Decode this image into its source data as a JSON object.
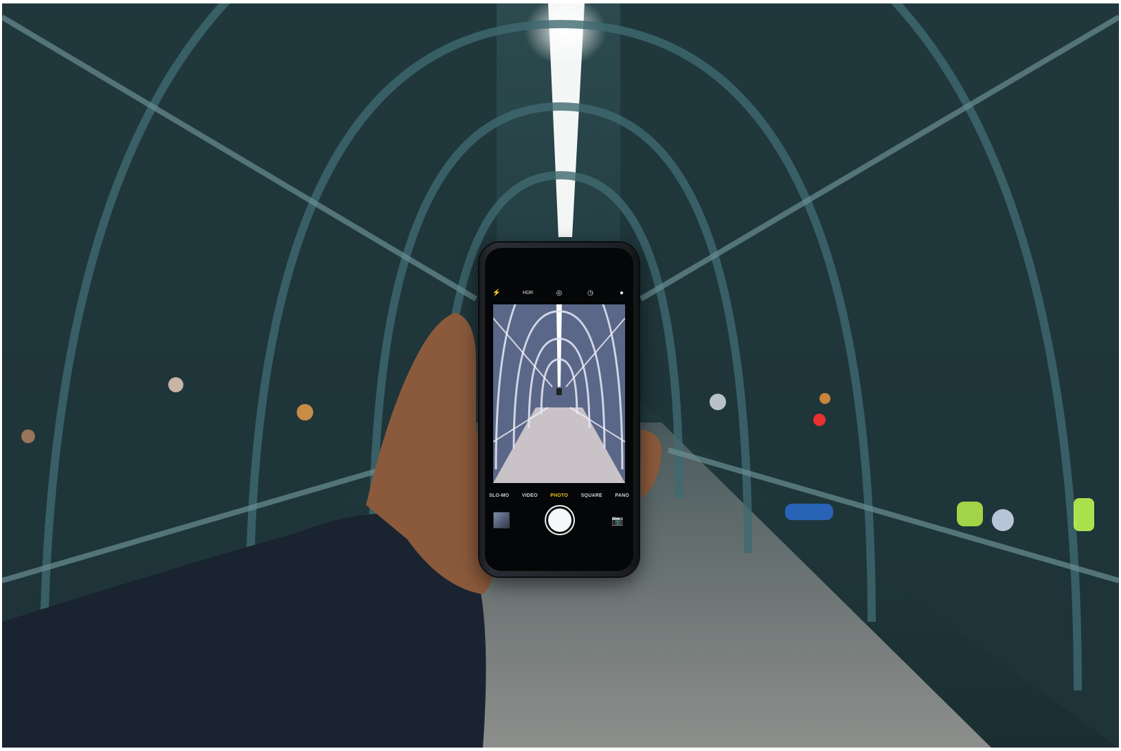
{
  "camera_app": {
    "top_icons": [
      {
        "icon": "flash-off-icon",
        "glyph": "⚡"
      },
      {
        "icon": "hdr-icon",
        "glyph": "HDR"
      },
      {
        "icon": "live-photo-icon",
        "glyph": "◎"
      },
      {
        "icon": "timer-icon",
        "glyph": "◷"
      },
      {
        "icon": "filters-icon",
        "glyph": "●"
      }
    ],
    "modes": [
      "SLO-MO",
      "VIDEO",
      "PHOTO",
      "SQUARE",
      "PANO"
    ],
    "active_mode": "PHOTO",
    "switch_camera_glyph": "📷"
  },
  "colors": {
    "active_mode": "#f4c21b",
    "tunnel_teal": "#2c4a4f",
    "viewfinder_purple": "#6b7897"
  }
}
